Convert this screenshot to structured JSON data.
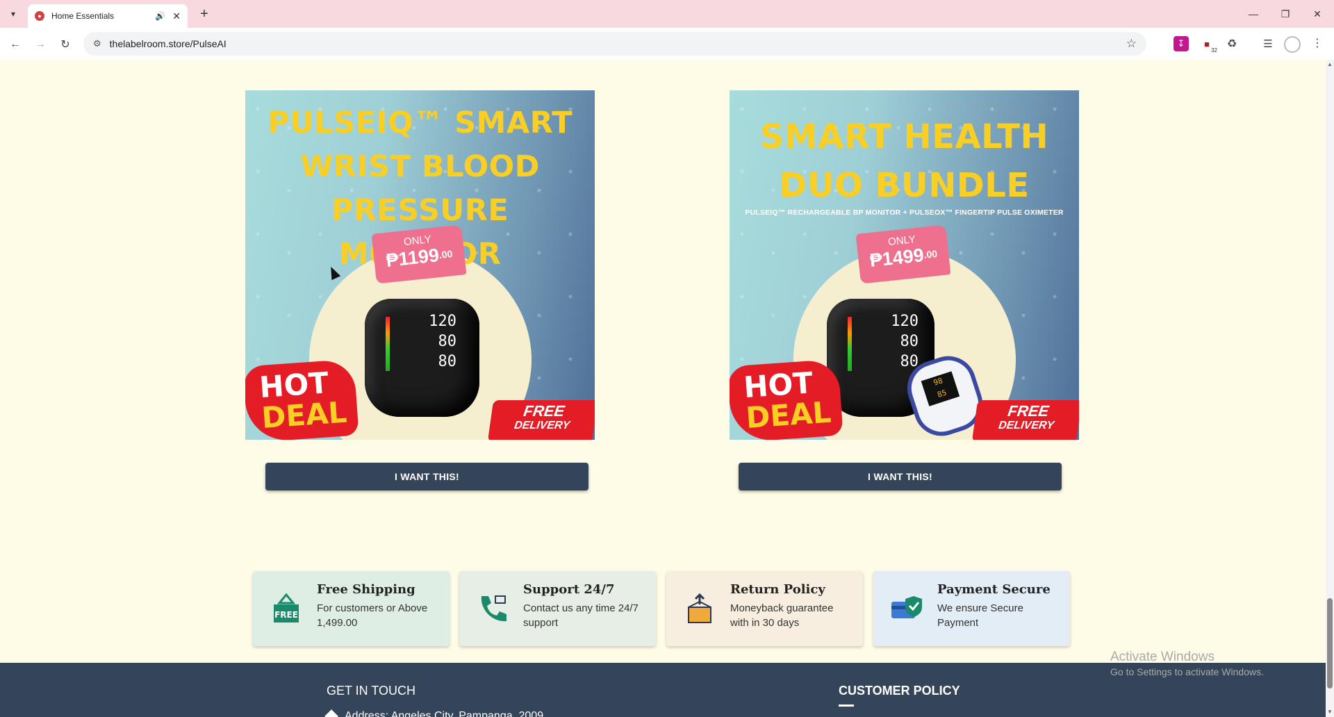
{
  "browser": {
    "tab_title": "Home Essentials",
    "url": "thelabelroom.store/PulseAI",
    "extension_badge": "32"
  },
  "products": [
    {
      "title_lines": [
        "PULSEIQ™ SMART",
        "WRIST BLOOD",
        "PRESSURE MONITOR"
      ],
      "subtitle": "",
      "price_label": "ONLY",
      "price": "₱1199",
      "price_cents": ".00",
      "screen": [
        "120",
        "80",
        "80"
      ],
      "badge_hot": "HOT",
      "badge_deal": "DEAL",
      "delivery_1": "FREE",
      "delivery_2": "DELIVERY",
      "cta": "I WANT THIS!"
    },
    {
      "title_lines": [
        "SMART HEALTH",
        "DUO BUNDLE"
      ],
      "subtitle": "PULSEIQ™ RECHARGEABLE BP MONITOR + PULSEOX™ FINGERTIP PULSE OXIMETER",
      "price_label": "ONLY",
      "price": "₱1499",
      "price_cents": ".00",
      "screen": [
        "120",
        "80",
        "80"
      ],
      "oximeter_screen": [
        "98",
        "85"
      ],
      "badge_hot": "HOT",
      "badge_deal": "DEAL",
      "delivery_1": "FREE",
      "delivery_2": "DELIVERY",
      "cta": "I WANT THIS!"
    }
  ],
  "features": [
    {
      "title": "Free Shipping",
      "desc": "For customers or Above 1,499.00",
      "icon": "free-shipping-icon"
    },
    {
      "title": "Support 24/7",
      "desc": "Contact us any time 24/7 support",
      "icon": "phone-support-icon"
    },
    {
      "title": "Return Policy",
      "desc": "Moneyback guarantee with in 30 days",
      "icon": "return-box-icon"
    },
    {
      "title": "Payment Secure",
      "desc": "We ensure Secure Payment",
      "icon": "secure-card-icon"
    }
  ],
  "footer": {
    "get_in_touch": "GET IN TOUCH",
    "customer_policy": "CUSTOMER POLICY",
    "address": "Address: Angeles City, Pampanga, 2009"
  },
  "watermark": {
    "line1": "Activate Windows",
    "line2": "Go to Settings to activate Windows."
  },
  "colors": {
    "page_bg": "#fefbe6",
    "button_bg": "#344459",
    "accent_yellow": "#f9cf25",
    "accent_red": "#e31c25"
  }
}
